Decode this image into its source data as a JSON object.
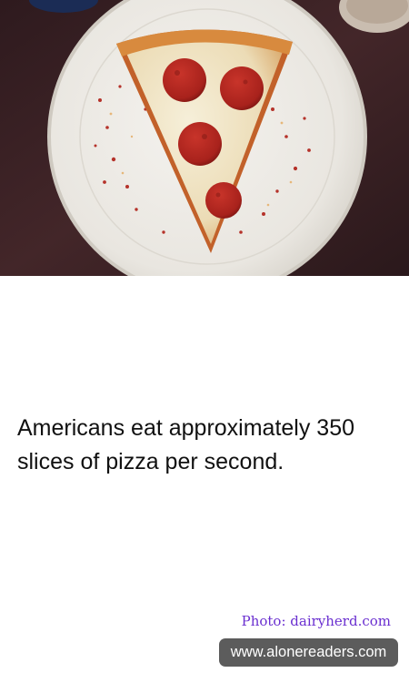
{
  "photo": {
    "subject": "pepperoni pizza slice on a white plate"
  },
  "fact": {
    "text": "Americans eat approximately 350 slices of pizza per second."
  },
  "credit": {
    "text": "Photo: dairyherd.com"
  },
  "site": {
    "url": "www.alonereaders.com"
  },
  "colors": {
    "credit_text": "#6a2fd0",
    "badge_background": "#5c5c5c",
    "background": "#ffffff"
  }
}
